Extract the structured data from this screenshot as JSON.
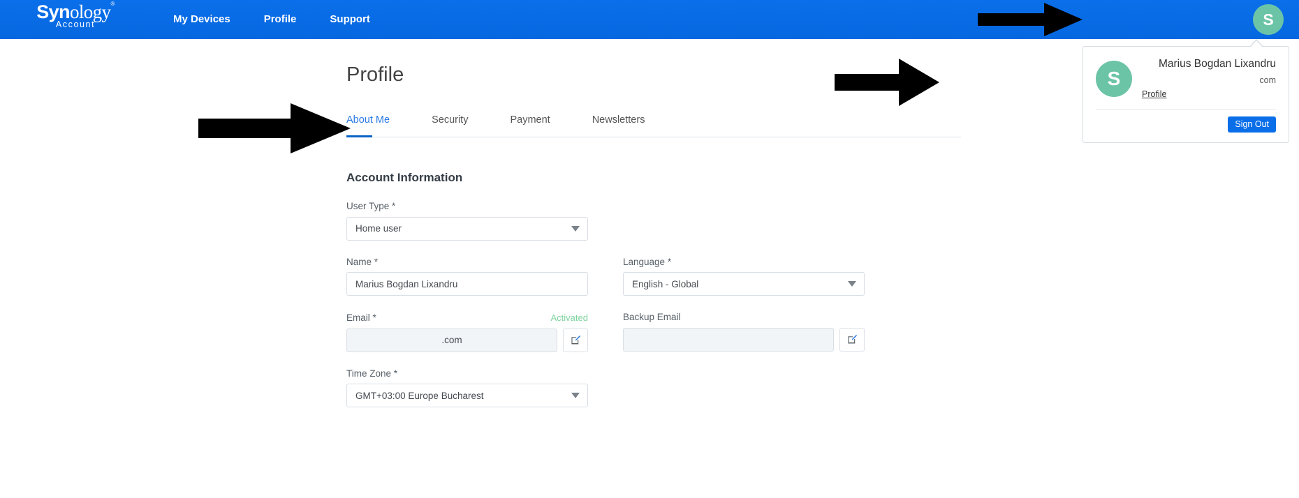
{
  "brand": {
    "logo_primary": "Syn",
    "logo_secondary": "ology",
    "logo_registered": "®",
    "logo_subtitle": "Account",
    "header_color": "#0a6ee8",
    "accent_color": "#0a64c8",
    "avatar_color": "#6cc4a7"
  },
  "header": {
    "nav_items": [
      {
        "label": "My Devices"
      },
      {
        "label": "Profile"
      },
      {
        "label": "Support"
      }
    ],
    "avatar_initial": "S"
  },
  "account_popover": {
    "avatar_initial": "S",
    "name": "Marius Bogdan Lixandru",
    "email": "com",
    "profile_link": "Profile",
    "sign_out_label": "Sign Out"
  },
  "main": {
    "page_title": "Profile",
    "tabs": [
      {
        "label": "About Me",
        "active": true
      },
      {
        "label": "Security",
        "active": false
      },
      {
        "label": "Payment",
        "active": false
      },
      {
        "label": "Newsletters",
        "active": false
      }
    ],
    "section_title": "Account Information",
    "fields": {
      "user_type": {
        "label": "User Type *",
        "value": "Home user"
      },
      "name": {
        "label": "Name *",
        "value": "Marius Bogdan Lixandru",
        "placeholder": ""
      },
      "language": {
        "label": "Language *",
        "value": "English - Global"
      },
      "email": {
        "label": "Email *",
        "value": ".com",
        "status": "Activated",
        "status_color": "#7ed49e"
      },
      "backup_email": {
        "label": "Backup Email",
        "value": "",
        "placeholder": ""
      },
      "time_zone": {
        "label": "Time Zone *",
        "value": "GMT+03:00 Europe Bucharest"
      }
    }
  },
  "annotations": [
    {
      "name": "arrow-to-header-avatar",
      "target": "header avatar"
    },
    {
      "name": "arrow-to-account-popover",
      "target": "account popover avatar"
    },
    {
      "name": "arrow-to-about-me-tab",
      "target": "About Me tab"
    }
  ]
}
